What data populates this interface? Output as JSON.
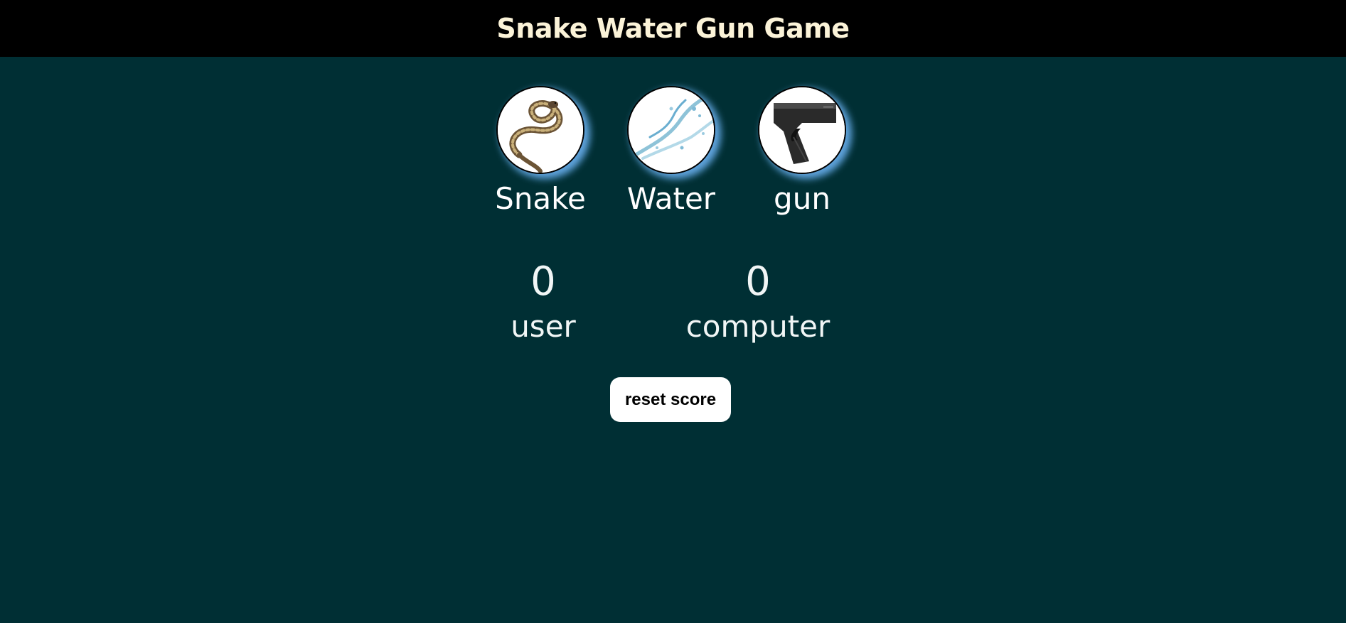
{
  "header": {
    "title": "Snake Water Gun Game"
  },
  "choices": [
    {
      "label": "Snake",
      "icon": "snake-image"
    },
    {
      "label": "Water",
      "icon": "water-splash-image"
    },
    {
      "label": "gun",
      "icon": "pistol-image"
    }
  ],
  "scoreboard": {
    "user": {
      "score": "0",
      "label": "user"
    },
    "computer": {
      "score": "0",
      "label": "computer"
    }
  },
  "reset_label": "reset score",
  "colors": {
    "background": "#002f34",
    "header_bg": "#000000",
    "title_color": "#fbf3d8",
    "glow": "#64aae6"
  }
}
